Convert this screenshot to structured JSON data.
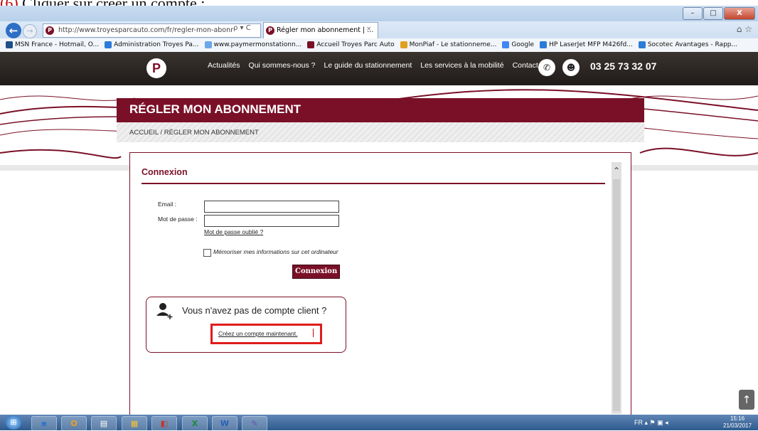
{
  "caption": {
    "number": "(6)",
    "text": "Cliquer sur créer un compte :"
  },
  "browser": {
    "address": "http://www.troyesparcauto.com/fr/regler-mon-abonr",
    "address_actions": "ρ ▾ C",
    "tab_title": "Régler mon abonnement | ...",
    "tab_close": "×",
    "window_buttons": {
      "minimize": "–",
      "maximize": "□",
      "close": "X"
    }
  },
  "favorites": [
    {
      "label": "MSN France - Hotmail, O...",
      "color": "#1e4f8a"
    },
    {
      "label": "Administration Troyes Pa...",
      "color": "#2b7bd8"
    },
    {
      "label": "www.paymermonstationn...",
      "color": "#6aa7e8"
    },
    {
      "label": "Accueil Troyes Parc Auto",
      "color": "#7a1027"
    },
    {
      "label": "MonPiaf - Le stationneme...",
      "color": "#e0a020"
    },
    {
      "label": "Google",
      "color": "#4285f4"
    },
    {
      "label": "HP LaserJet MFP M426fd...",
      "color": "#2b7bd8"
    },
    {
      "label": "Socotec Avantages - Rapp...",
      "color": "#2b7bd8"
    }
  ],
  "site": {
    "logo_letter": "P",
    "nav": [
      "Actualités",
      "Qui sommes-nous ?",
      "Le guide du stationnement",
      "Les services à la mobilité",
      "Contact"
    ],
    "phone": "03 25 73 32 07",
    "page_title": "RÉGLER MON ABONNEMENT",
    "breadcrumb": "ACCUEIL / RÉGLER MON ABONNEMENT"
  },
  "login": {
    "heading": "Connexion",
    "email_label": "Email :",
    "password_label": "Mot de passe :",
    "email_value": "",
    "password_value": "",
    "forgot_link": "Mot de passe oublié ?",
    "remember_label": "Mémoriser mes informations sur cet ordinateur",
    "submit_label": "Connexion"
  },
  "no_account": {
    "question": "Vous n'avez pas de compte client ?",
    "create_link": "Créez un compte maintenant."
  },
  "taskbar": {
    "apps": [
      "e",
      "O",
      "▤",
      "▦",
      "◧",
      "X",
      "W",
      "✎"
    ],
    "tray_lang": "FR",
    "time": "15:16",
    "date": "21/03/2017"
  },
  "colors": {
    "brand": "#7a1027",
    "highlight": "#e01b1b"
  }
}
